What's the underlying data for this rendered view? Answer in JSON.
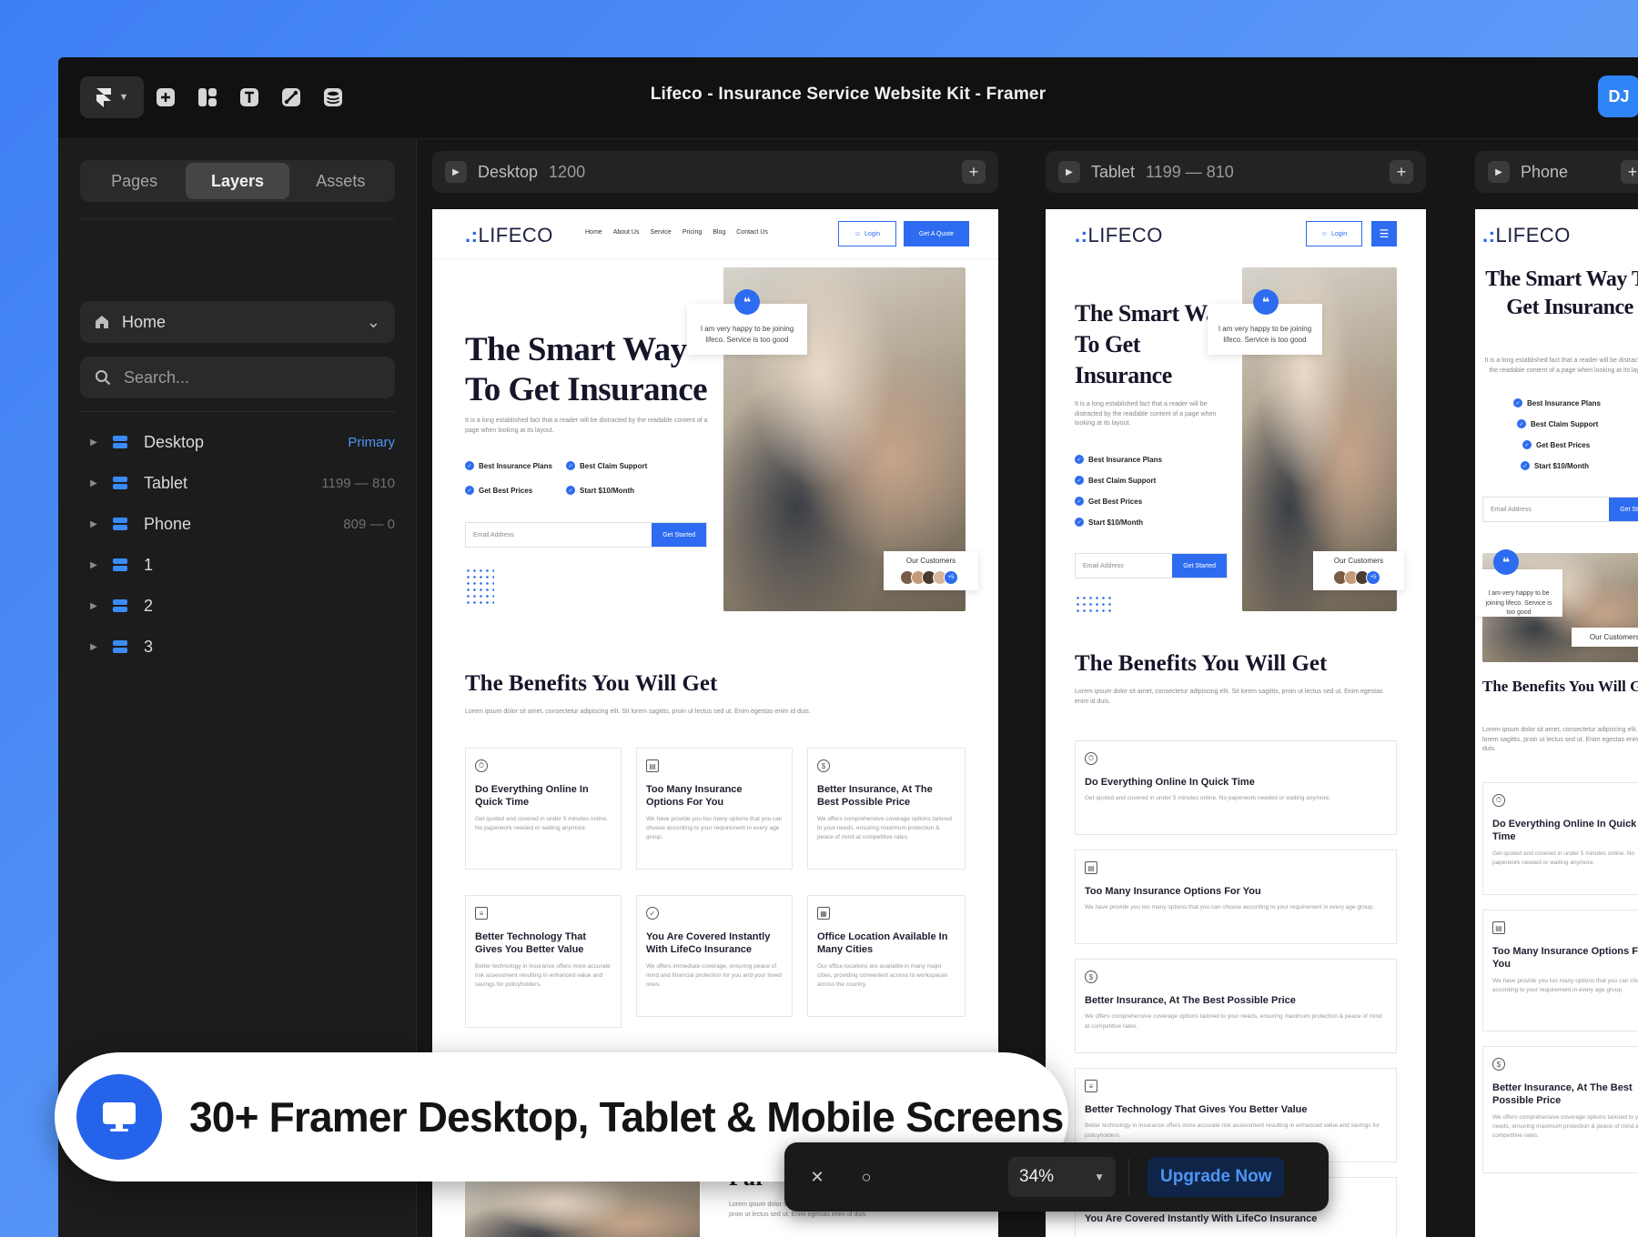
{
  "app": {
    "title": "Lifeco - Insurance Service Website Kit - Framer",
    "avatar": "DJ"
  },
  "toolbar": {
    "icons": [
      "framer-logo-icon",
      "insert-icon",
      "layout-icon",
      "text-icon",
      "vector-icon",
      "cms-icon"
    ]
  },
  "left_panel": {
    "tabs": [
      {
        "label": "Pages",
        "active": false
      },
      {
        "label": "Layers",
        "active": true
      },
      {
        "label": "Assets",
        "active": false
      }
    ],
    "page_select": "Home",
    "search_placeholder": "Search...",
    "layers": [
      {
        "name": "Desktop",
        "meta": "Primary"
      },
      {
        "name": "Tablet",
        "meta": "1199 — 810"
      },
      {
        "name": "Phone",
        "meta": "809 — 0"
      },
      {
        "name": "1",
        "meta": ""
      },
      {
        "name": "2",
        "meta": ""
      },
      {
        "name": "3",
        "meta": ""
      }
    ]
  },
  "frames": {
    "desktop": {
      "name": "Desktop",
      "size": "1200"
    },
    "tablet": {
      "name": "Tablet",
      "size": "1199 — 810"
    },
    "phone": {
      "name": "Phone",
      "size": ""
    }
  },
  "site": {
    "logo": "LIFECO",
    "nav": [
      "Home",
      "About Us",
      "Service",
      "Pricing",
      "Blog",
      "Contact Us"
    ],
    "login": "Login",
    "quote_btn": "Get A Quote",
    "hero_title_desktop": "The Smart Way To Get Insurance",
    "hero_desc": "It is a long established fact that a reader will be distracted by the readable content of a page when looking at its layout.",
    "checks": [
      "Best Insurance Plans",
      "Best Claim Support",
      "Get Best Prices",
      "Start $10/Month"
    ],
    "email_placeholder": "Email Address",
    "cta": "Get Started",
    "testimonial": "I am very happy to be joining lifeco. Service is too good",
    "customers": "Our Customers",
    "customers_more": "+5",
    "benefits_title": "The Benefits You Will Get",
    "benefits_desc": "Lorem ipsum dolor sit amet, consectetur adipiscing elit. Sit lorem sagittis, proin ut lectus sed ut. Enim egestas enim id duis.",
    "cards": [
      {
        "title": "Do Everything Online In Quick Time",
        "desc": "Get quoted and covered in under 5 minutes online. No paperwork needed or waiting anymore."
      },
      {
        "title": "Too Many Insurance Options For You",
        "desc": "We have provide you too many options that you can choose according to your requirement in every age group."
      },
      {
        "title": "Better Insurance, At The Best Possible Price",
        "desc": "We offers comprehensive coverage options tailored to your needs, ensuring maximum protection & peace of mind at competitive rates."
      },
      {
        "title": "Better Technology That Gives You Better Value",
        "desc": "Better technology in insurance offers more accurate risk assessment resulting in enhanced value and savings for policyholders."
      },
      {
        "title": "You Are Covered Instantly With LifeCo Insurance",
        "desc": "We offers immediate coverage, ensuring peace of mind and financial protection for you and your loved ones."
      },
      {
        "title": "Office Location Available In Many Cities",
        "desc": "Our office locations are available in many major cities, providing convenient access to workspaces across the country."
      }
    ],
    "purpose_fragment": "Pur",
    "purpose_desc": "Lorem ipsum dolor sit amet, consectetur adipiscing elit. Sit lorem sagittis, proin ut lectus sed ut. Enim egestas enim id duis."
  },
  "promo": {
    "text": "30+ Framer Desktop, Tablet & Mobile Screens"
  },
  "zoom": {
    "value": "34%",
    "upgrade": "Upgrade Now"
  },
  "colors": {
    "accent": "#2563eb",
    "framer_blue": "#2f84f6",
    "panel": "#1c1c1c"
  }
}
